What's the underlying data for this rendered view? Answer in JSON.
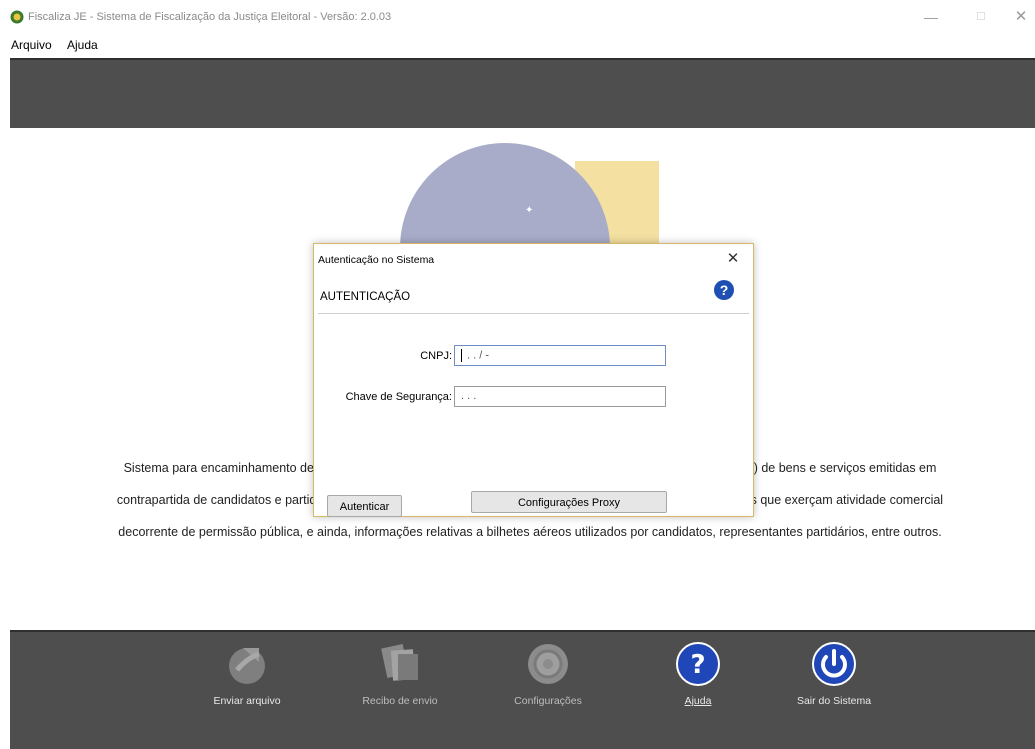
{
  "window": {
    "title": "Fiscaliza JE - Sistema de Fiscalização da Justiça Eleitoral - Versão: 2.0.03",
    "minimize": "—",
    "maximize": "☐",
    "close": "✕"
  },
  "menu": {
    "items": [
      {
        "label": "Arquivo"
      },
      {
        "label": "Ajuda"
      }
    ]
  },
  "content": {
    "description": "Sistema para encaminhamento de arquivos digitais com informações relativas às Notas Fiscais Eletrônicas (NFes) de bens e serviços emitidas em contrapartida de candidatos e partidos políticos, bem como o encaminhamento da identificação das pessoas físicas que exerçam atividade comercial decorrente de permissão pública, e ainda, informações relativas a bilhetes aéreos utilizados por candidatos, representantes partidários, entre outros."
  },
  "toolbar": {
    "items": [
      {
        "label": "Enviar arquivo",
        "icon": "upload-icon"
      },
      {
        "label": "Recibo de envio",
        "icon": "receipt-icon"
      },
      {
        "label": "Configurações",
        "icon": "settings-icon"
      },
      {
        "label": "Ajuda",
        "icon": "help-icon"
      },
      {
        "label": "Sair do Sistema",
        "icon": "power-icon"
      }
    ]
  },
  "dialog": {
    "title": "Autenticação no Sistema",
    "close": "✕",
    "header": "AUTENTICAÇÃO",
    "help_glyph": "?",
    "cnpj_label": "CNPJ:",
    "cnpj_value": " .   .   /   -",
    "chave_label": "Chave de Segurança:",
    "chave_value": " .   .   .",
    "autenticar_label": "Autenticar",
    "proxy_label": "Configurações Proxy"
  },
  "colors": {
    "band": "#4e4e4e",
    "dialog_border": "#d7b86a",
    "help_blue": "#1f4fb3"
  }
}
